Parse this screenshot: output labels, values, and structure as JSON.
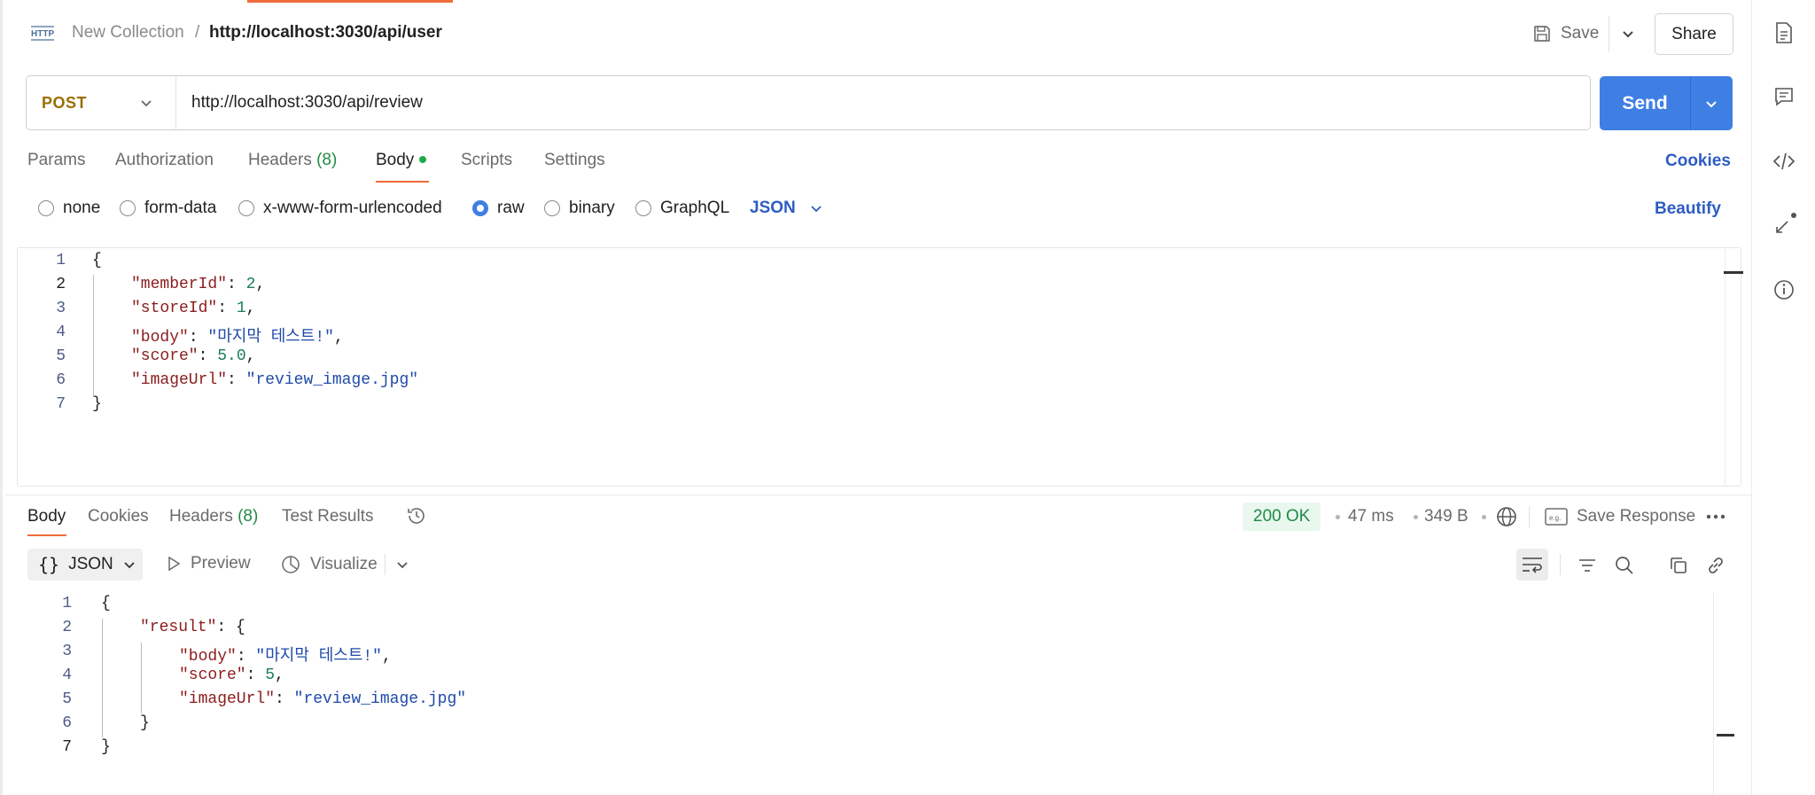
{
  "header": {
    "collection": "New Collection",
    "separator": "/",
    "request_name": "http://localhost:3030/api/user",
    "save_label": "Save",
    "share_label": "Share"
  },
  "request": {
    "method": "POST",
    "url": "http://localhost:3030/api/review",
    "send_label": "Send"
  },
  "request_tabs": {
    "params": "Params",
    "authorization": "Authorization",
    "headers": "Headers",
    "headers_count": "(8)",
    "body": "Body",
    "scripts": "Scripts",
    "settings": "Settings",
    "cookies": "Cookies"
  },
  "body_types": {
    "none": "none",
    "form_data": "form-data",
    "urlencoded": "x-www-form-urlencoded",
    "raw": "raw",
    "binary": "binary",
    "graphql": "GraphQL",
    "selected": "raw",
    "format": "JSON",
    "beautify": "Beautify"
  },
  "request_body": {
    "line_numbers": [
      "1",
      "2",
      "3",
      "4",
      "5",
      "6",
      "7"
    ],
    "open": "{",
    "close": "}",
    "fields": [
      {
        "key": "\"memberId\"",
        "value": "2",
        "trail": ","
      },
      {
        "key": "\"storeId\"",
        "value": "1",
        "trail": ","
      },
      {
        "key": "\"body\"",
        "value": "\"마지막 테스트!\"",
        "trail": ","
      },
      {
        "key": "\"score\"",
        "value": "5.0",
        "trail": ","
      },
      {
        "key": "\"imageUrl\"",
        "value": "\"review_image.jpg\"",
        "trail": ""
      }
    ]
  },
  "response_tabs": {
    "body": "Body",
    "cookies": "Cookies",
    "headers": "Headers",
    "headers_count": "(8)",
    "test_results": "Test Results"
  },
  "response_meta": {
    "status": "200 OK",
    "time": "47 ms",
    "size": "349 B",
    "save_response": "Save Response"
  },
  "response_toolbar": {
    "format": "JSON",
    "preview": "Preview",
    "visualize": "Visualize"
  },
  "response_body": {
    "line_numbers": [
      "1",
      "2",
      "3",
      "4",
      "5",
      "6",
      "7"
    ],
    "open": "{",
    "result_key": "\"result\"",
    "result_open": "{",
    "fields": [
      {
        "key": "\"body\"",
        "value": "\"마지막 테스트!\"",
        "trail": ","
      },
      {
        "key": "\"score\"",
        "value": "5",
        "trail": ","
      },
      {
        "key": "\"imageUrl\"",
        "value": "\"review_image.jpg\"",
        "trail": ""
      }
    ],
    "result_close": "}",
    "close": "}"
  },
  "icons": {
    "http": "http-icon",
    "save": "save-disk-icon",
    "rail": [
      "document-icon",
      "comment-icon",
      "code-icon",
      "related-collections-icon",
      "info-icon"
    ]
  },
  "colors": {
    "accent": "#f26b3a",
    "send": "#3f7fe4",
    "link": "#2e5cc4",
    "method_post": "#9a6e00",
    "success": "#1f8a45"
  }
}
